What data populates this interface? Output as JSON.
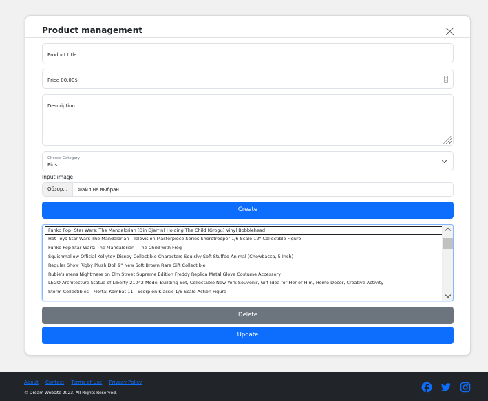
{
  "modal": {
    "title": "Product management",
    "fields": {
      "product_title_placeholder": "Product title",
      "price_placeholder": "Price 00.00$",
      "description_placeholder": "Description",
      "category_label": "Choose Category",
      "category_value": "Pins",
      "input_image_label": "Input image",
      "file_button": "Обзор...",
      "file_status": "Файл не выбран."
    },
    "buttons": {
      "create": "Create",
      "delete": "Delete",
      "update": "Update"
    },
    "product_list": [
      "Funko Pop! Star Wars: The Mandalorian (Din Djarrin) Holding The Child (Grogu) Vinyl Bobblehead",
      "Hot Toys Star Wars The Mandalorian - Television Masterpiece Series Shoretrooper 1/6 Scale 12\" Collectible Figure",
      "Funko Pop Star Wars: The Mandalorian - The Child with Frog",
      "Squishmallow Official Kellytoy Disney Collectible Characters Squishy Soft Stuffed Animal (Chewbacca, 5 Inch)",
      "Regular Show Rigby Plush Doll 9\" New Soft Brown Rare Gift Collectible",
      "Rubie's mens Nightmare on Elm Street Supreme Edition Freddy Replica Metal Glove Costume Accessory",
      "LEGO Architecture Statue of Liberty 21042 Model Building Set, Collectable New York Souvenir, Gift Idea for Her or Him, Home Décor, Creative Activity",
      "Storm Collectibles - Mortal Kombat 11 - Scorpion Klassic 1/6 Scale Action Figure"
    ]
  },
  "footer": {
    "links": [
      "About",
      "Contact",
      "Terms of Use",
      "Privacy Policy"
    ],
    "separator": "·",
    "copyright": "© Dream Website 2023. All Rights Reserved.",
    "social_icons": [
      "facebook-icon",
      "twitter-icon",
      "instagram-icon"
    ]
  },
  "colors": {
    "primary": "#0d6efd",
    "secondary": "#6c757d",
    "footer_bg": "#212529",
    "page_bg": "#f1f1f1"
  }
}
